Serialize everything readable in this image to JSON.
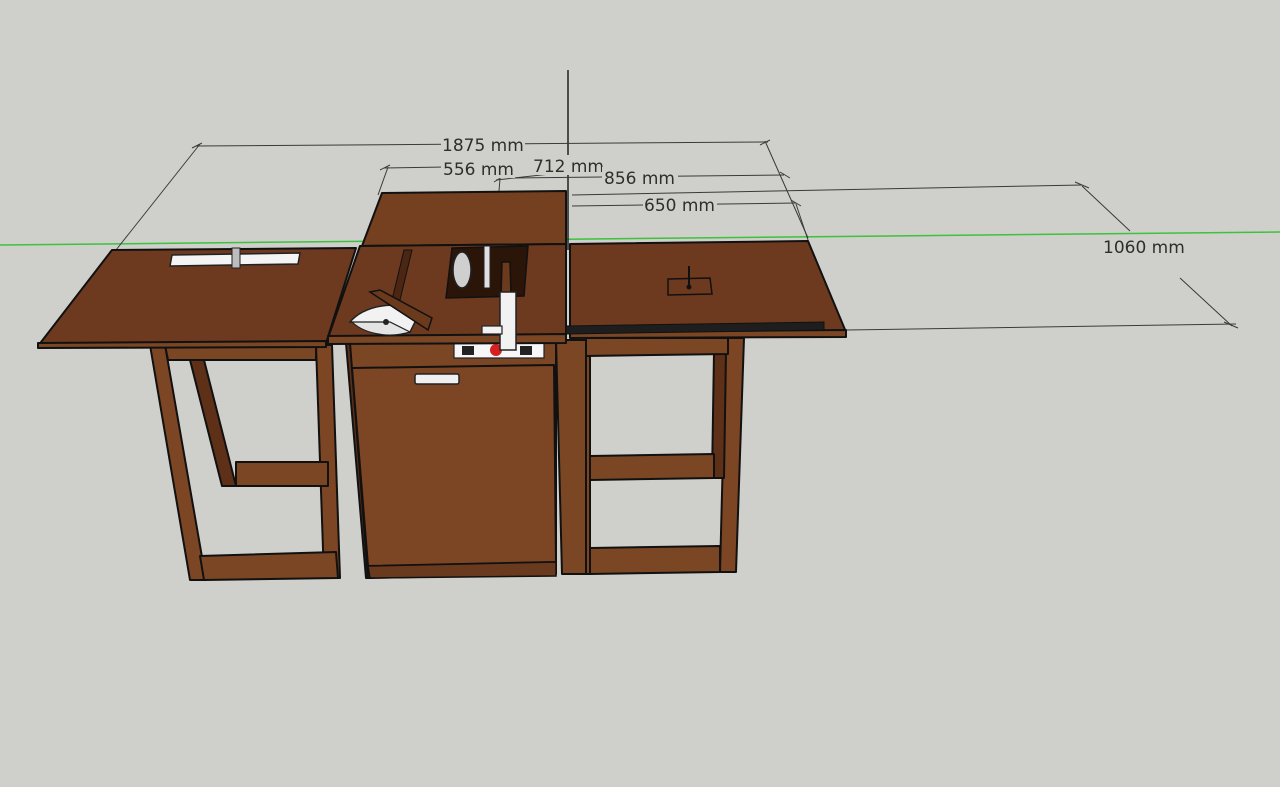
{
  "dimensions": [
    {
      "id": "overall-width",
      "label": "1875 mm"
    },
    {
      "id": "saw-top-width",
      "label": "556 mm"
    },
    {
      "id": "saw-depth",
      "label": "712 mm"
    },
    {
      "id": "right-span",
      "label": "856 mm"
    },
    {
      "id": "right-wing-width",
      "label": "650 mm"
    },
    {
      "id": "depth",
      "label": "1060 mm"
    }
  ],
  "colors": {
    "background": "#cfd0cb",
    "wood": "#6e3a1f",
    "axis_green": "#3cc23c",
    "axis_black": "#222222"
  },
  "icons": [
    "miter-gauge-icon",
    "saw-blade-icon",
    "rip-fence-icon",
    "router-plate-icon",
    "switch-box-icon",
    "drawer-handle-icon"
  ]
}
